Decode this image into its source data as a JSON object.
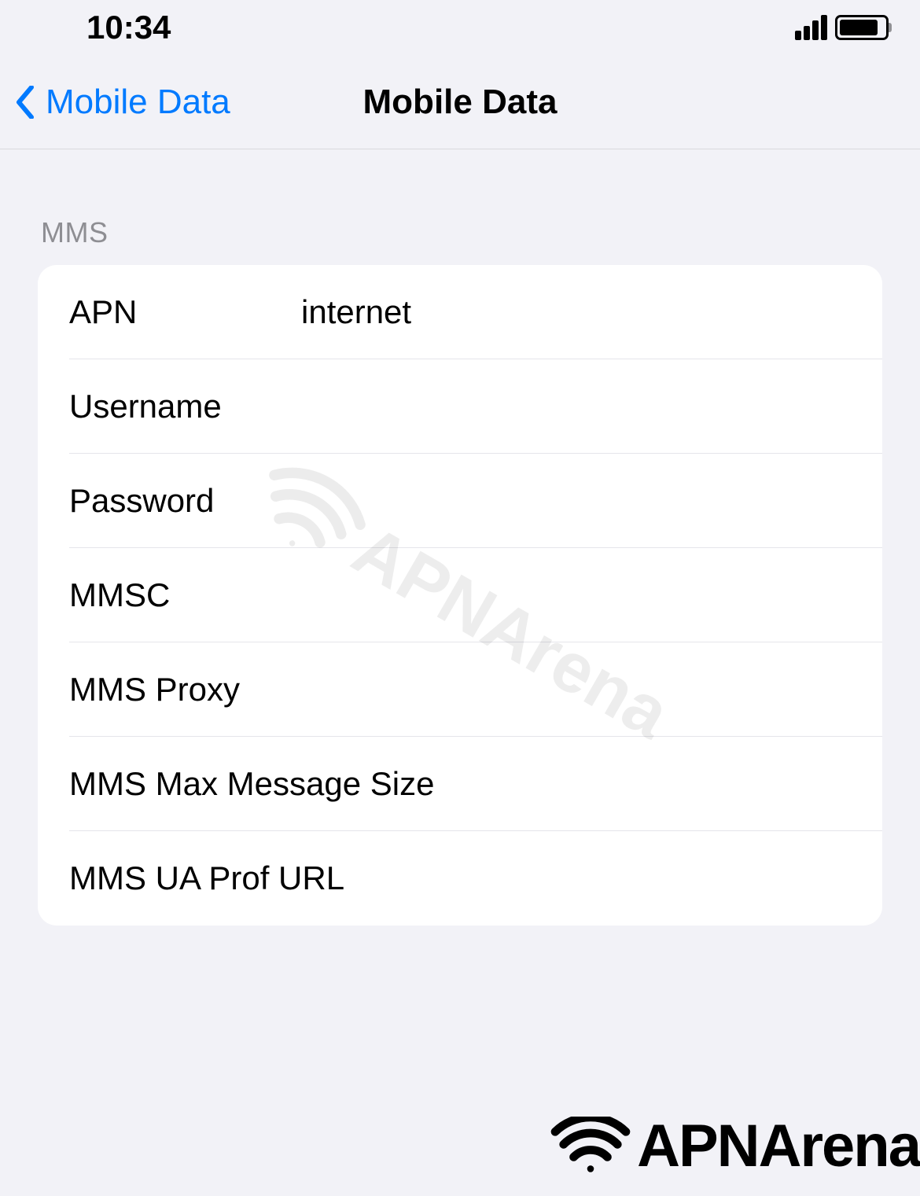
{
  "status_bar": {
    "time": "10:34"
  },
  "nav": {
    "back_label": "Mobile Data",
    "title": "Mobile Data"
  },
  "section": {
    "header": "MMS",
    "rows": [
      {
        "label": "APN",
        "value": "internet"
      },
      {
        "label": "Username",
        "value": ""
      },
      {
        "label": "Password",
        "value": ""
      },
      {
        "label": "MMSC",
        "value": ""
      },
      {
        "label": "MMS Proxy",
        "value": ""
      },
      {
        "label": "MMS Max Message Size",
        "value": ""
      },
      {
        "label": "MMS UA Prof URL",
        "value": ""
      }
    ]
  },
  "watermark": {
    "text": "APNArena"
  }
}
